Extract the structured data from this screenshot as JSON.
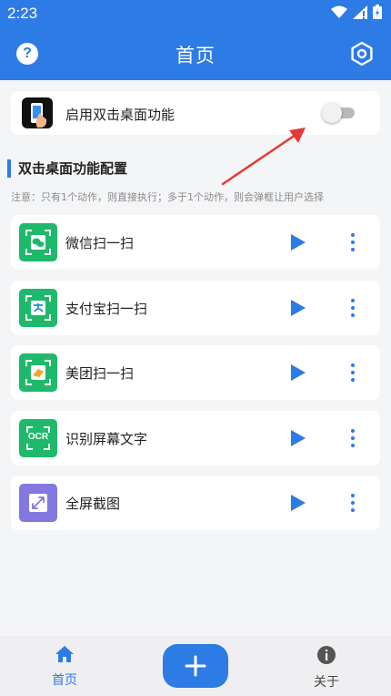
{
  "status_bar": {
    "time": "2:23"
  },
  "header": {
    "title": "首页",
    "help_symbol": "?",
    "settings_icon": "settings-hexagon-icon",
    "color": "#2d7be5"
  },
  "toggle_card": {
    "label": "启用双击桌面功能",
    "enabled": false,
    "icon": "phone-tap-icon"
  },
  "section": {
    "title": "双击桌面功能配置",
    "note": "注意：只有1个动作，则直接执行；多于1个动作，则会弹框让用户选择"
  },
  "actions": [
    {
      "label": "微信扫一扫",
      "icon": "wechat-scan-icon",
      "color": "#1fb96b"
    },
    {
      "label": "支付宝扫一扫",
      "icon": "alipay-scan-icon",
      "color": "#1fb96b"
    },
    {
      "label": "美团扫一扫",
      "icon": "meituan-scan-icon",
      "color": "#1fb96b"
    },
    {
      "label": "识别屏幕文字",
      "icon": "ocr-icon",
      "icon_text": "OCR",
      "color": "#1fb96b"
    },
    {
      "label": "全屏截图",
      "icon": "fullscreen-screenshot-icon",
      "color": "#8378e0"
    }
  ],
  "bottom_nav": {
    "home_label": "首页",
    "about_label": "关于",
    "add_icon": "plus-icon"
  }
}
